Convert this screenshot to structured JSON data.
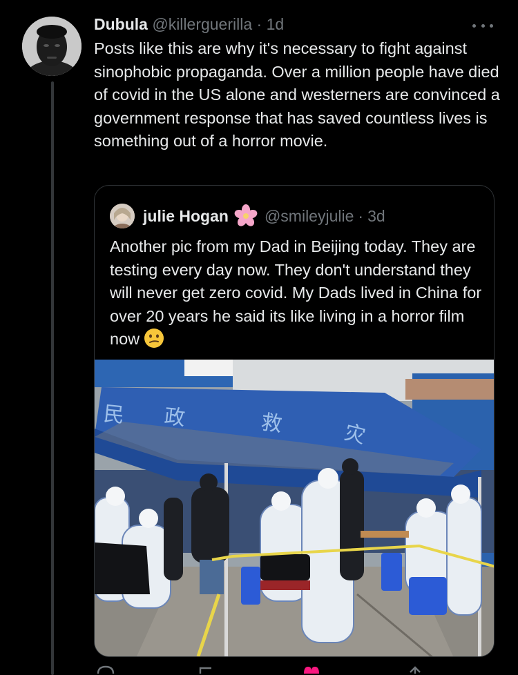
{
  "tweet": {
    "author_name": "Dubula",
    "author_handle": "@killerguerilla",
    "separator": "·",
    "time": "1d",
    "text": "Posts like this are why it's necessary to fight against sinophobic propaganda. Over a million people have died of covid in the US alone and westerners are convinced a government response that has saved countless lives is something out of a horror movie."
  },
  "quoted_tweet": {
    "author_name": "julie Hogan",
    "author_emoji_icon": "cherry-blossom-icon",
    "author_handle": "@smileyjulie",
    "separator": "·",
    "time": "3d",
    "text": "Another pic from my Dad in Beijing today. They are testing every day now. They don't understand they will never get zero covid. My Dads lived in China for over 20 years he said its like living in a horror film now",
    "trailing_emoji_icon": "confused-face-icon"
  },
  "photo": {
    "tent_characters": [
      "民",
      "政",
      "救",
      "灾"
    ]
  },
  "icons": {
    "more": "more-options-icon",
    "actions": [
      "reply-icon",
      "retweet-icon",
      "like-icon",
      "share-icon"
    ]
  },
  "colors": {
    "background": "#000000",
    "text_primary": "#e7e9ea",
    "text_secondary": "#71767b",
    "border": "#2f3336",
    "tent_blue": "#2f5fb3"
  }
}
